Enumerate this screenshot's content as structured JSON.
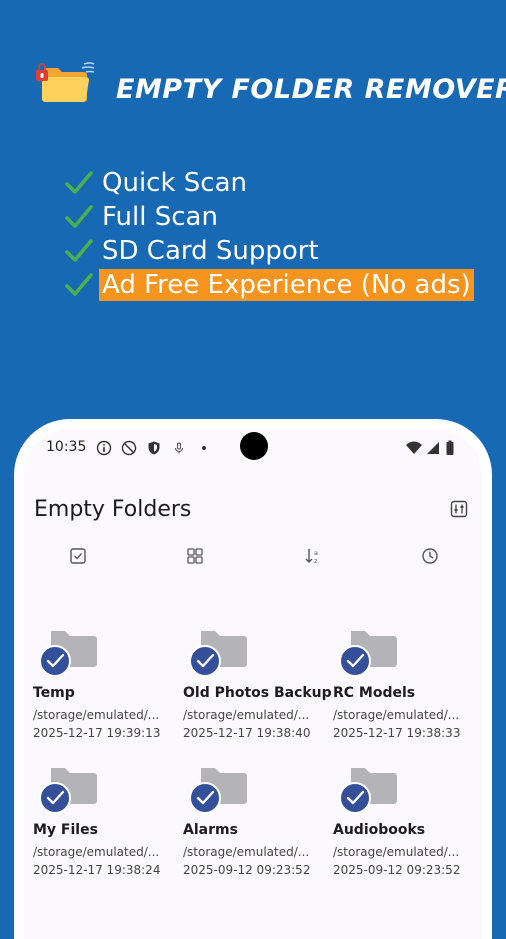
{
  "hero": {
    "title": "EMPTY FOLDER REMOVER",
    "logo_icon": "folder-with-lock-icon",
    "features": [
      {
        "label": "Quick Scan",
        "highlight": false
      },
      {
        "label": "Full Scan",
        "highlight": false
      },
      {
        "label": "SD Card Support",
        "highlight": false
      },
      {
        "label": "Ad Free Experience (No ads)",
        "highlight": true
      }
    ],
    "check_color": "#4caf50",
    "highlight_color": "#f7941d"
  },
  "status_bar": {
    "time": "10:35",
    "icons": [
      "info-icon",
      "do-not-disturb-icon",
      "shield-icon",
      "accessibility-icon",
      "dot-icon",
      "wifi-icon",
      "signal-icon",
      "battery-icon"
    ]
  },
  "app": {
    "title": "Empty Folders",
    "filter_icon": "filter-settings-icon",
    "toolbar": [
      "select-all-icon",
      "grid-view-icon",
      "sort-icon",
      "history-icon"
    ]
  },
  "folders": [
    {
      "name": "Temp",
      "path": "/storage/emulated/...",
      "date": "2025-12-17 19:39:13",
      "checked": true
    },
    {
      "name": "Old Photos Backup",
      "path": "/storage/emulated/...",
      "date": "2025-12-17 19:38:40",
      "checked": true
    },
    {
      "name": "RC Models",
      "path": "/storage/emulated/...",
      "date": "2025-12-17 19:38:33",
      "checked": true
    },
    {
      "name": "My Files",
      "path": "/storage/emulated/...",
      "date": "2025-12-17 19:38:24",
      "checked": true
    },
    {
      "name": "Alarms",
      "path": "/storage/emulated/...",
      "date": "2025-09-12 09:23:52",
      "checked": true
    },
    {
      "name": "Audiobooks",
      "path": "/storage/emulated/...",
      "date": "2025-09-12 09:23:52",
      "checked": true
    }
  ],
  "colors": {
    "background": "#1769b3",
    "folder": "#b4b4b8",
    "check_badge": "#34509a"
  }
}
